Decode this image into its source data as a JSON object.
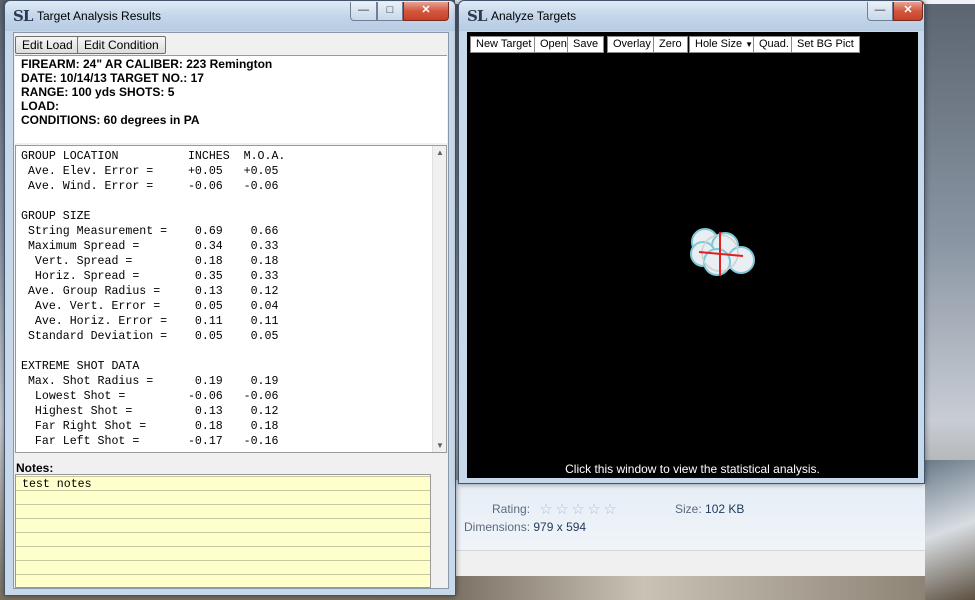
{
  "results_window": {
    "title": "Target Analysis Results",
    "logo": "SL",
    "buttons": {
      "edit_load": "Edit Load",
      "edit_condition": "Edit Condition"
    },
    "info": {
      "firearm": "FIREARM: 24\" AR   CALIBER: 223 Remington",
      "date": "DATE: 10/14/13   TARGET NO.: 17",
      "range": "RANGE: 100 yds    SHOTS: 5",
      "load": "LOAD:",
      "conditions": "CONDITIONS: 60 degrees in PA"
    },
    "stats_lines": [
      "GROUP LOCATION          INCHES  M.O.A.",
      " Ave. Elev. Error =     +0.05   +0.05",
      " Ave. Wind. Error =     -0.06   -0.06",
      "",
      "GROUP SIZE",
      " String Measurement =    0.69    0.66",
      " Maximum Spread =        0.34    0.33",
      "  Vert. Spread =         0.18    0.18",
      "  Horiz. Spread =        0.35    0.33",
      " Ave. Group Radius =     0.13    0.12",
      "  Ave. Vert. Error =     0.05    0.04",
      "  Ave. Horiz. Error =    0.11    0.11",
      " Standard Deviation =    0.05    0.05",
      "",
      "EXTREME SHOT DATA",
      " Max. Shot Radius =      0.19    0.19",
      "  Lowest Shot =         -0.06   -0.06",
      "  Highest Shot =         0.13    0.12",
      "  Far Right Shot =       0.18    0.18",
      "  Far Left Shot =       -0.17   -0.16"
    ],
    "notes_label": "Notes:",
    "notes_value": "test notes"
  },
  "analyze_window": {
    "title": "Analyze Targets",
    "logo": "SL",
    "toolbar": [
      "New Target",
      "Open",
      "Save",
      "Overlay",
      "Zero",
      "Hole Size",
      "Quad.",
      "Set BG Pict"
    ],
    "hint": "Click this window to view the statistical analysis."
  },
  "window_controls": {
    "minimize": "—",
    "maximize": "□",
    "close": "✕"
  },
  "explorer_details": {
    "rating_label": "Rating:",
    "rating_stars": 0,
    "size_label": "Size:",
    "size_value": "102 KB",
    "dimensions_label": "Dimensions:",
    "dimensions_value": "979 x 594"
  }
}
